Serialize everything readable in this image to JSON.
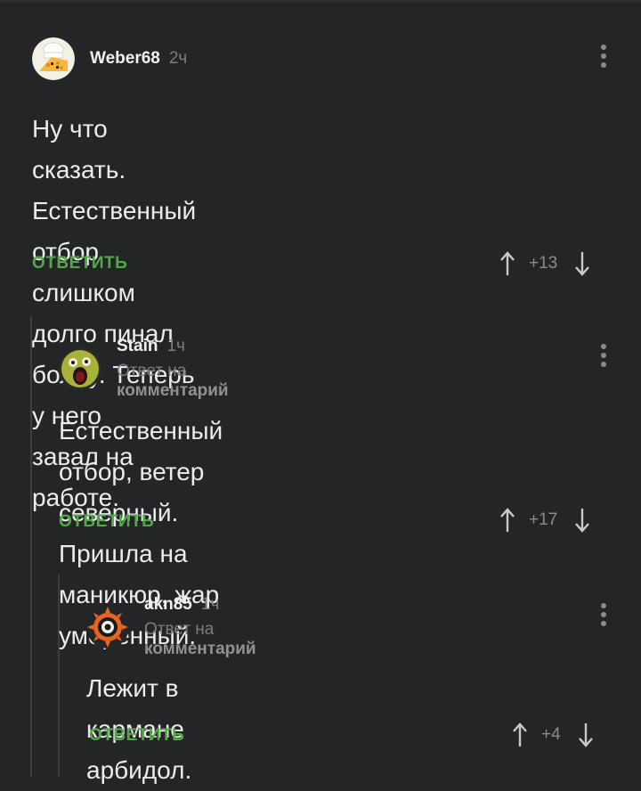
{
  "comments": [
    {
      "username": "Weber68",
      "time": "2ч",
      "text_lines": [
        "Ну что сказать. Естественный отбор",
        "слишком долго пинал болду. Теперь у него",
        "завал на работе."
      ],
      "reply_label": "ОТВЕТИТЬ",
      "rating": "+13",
      "avatar_icon": "cheese-chef-icon"
    },
    {
      "username": "Stain",
      "time": "1ч",
      "reply_to_prefix": "Ответ на",
      "reply_to_link": "комментарий",
      "text_lines": [
        "Естественный отбор, ветер северный.",
        "Пришла на маникюр, жар умеренный."
      ],
      "reply_label": "ОТВЕТИТЬ",
      "rating": "+17",
      "avatar_icon": "screaming-face-icon"
    },
    {
      "username": "akn85",
      "time": "1ч",
      "reply_to_prefix": "Ответ на",
      "reply_to_link": "комментарий",
      "text_lines": [
        "Лежит в кармане арбидол."
      ],
      "reply_label": "ОТВЕТИТЬ",
      "rating": "+4",
      "avatar_icon": "sun-eye-icon"
    }
  ],
  "colors": {
    "background": "#232526",
    "reply_green": "#55a84a",
    "muted": "#7b7e80"
  }
}
